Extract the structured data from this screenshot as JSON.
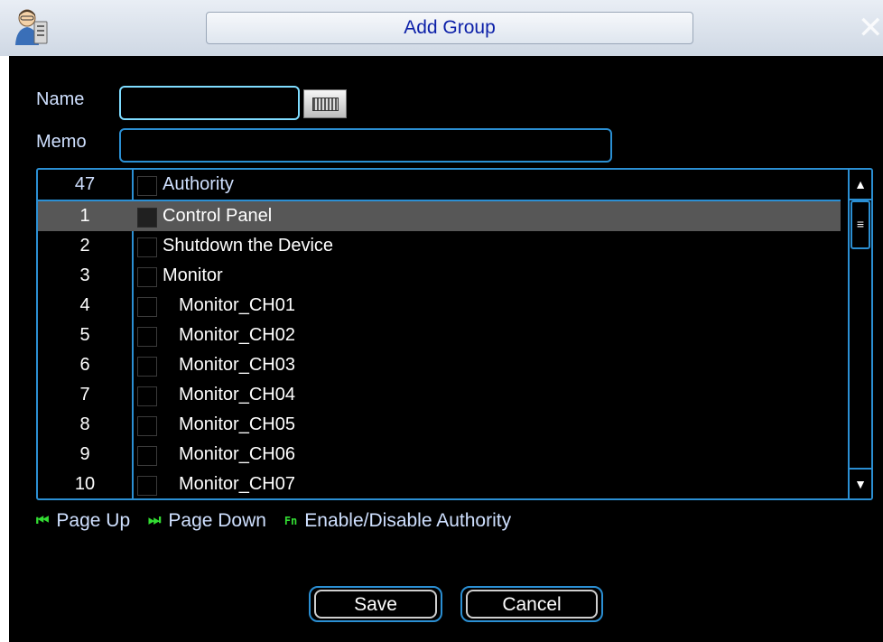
{
  "window": {
    "title": "Add Group",
    "close_icon": "close-icon",
    "app_icon": "user-group-icon"
  },
  "form": {
    "name_label": "Name",
    "name_value": "",
    "memo_label": "Memo",
    "memo_value": "",
    "keyboard_icon": "keyboard-icon"
  },
  "table": {
    "header": {
      "count": "47",
      "title": "Authority"
    },
    "rows": [
      {
        "num": "1",
        "name": "Control Panel",
        "selected": true
      },
      {
        "num": "2",
        "name": "Shutdown the Device"
      },
      {
        "num": "3",
        "name": "Monitor"
      },
      {
        "num": "4",
        "name": "Monitor_CH01"
      },
      {
        "num": "5",
        "name": "Monitor_CH02"
      },
      {
        "num": "6",
        "name": "Monitor_CH03"
      },
      {
        "num": "7",
        "name": "Monitor_CH04"
      },
      {
        "num": "8",
        "name": "Monitor_CH05"
      },
      {
        "num": "9",
        "name": "Monitor_CH06"
      },
      {
        "num": "10",
        "name": "Monitor_CH07"
      }
    ]
  },
  "hints": {
    "page_up": "Page Up",
    "page_down": "Page Down",
    "fn_key": "Fn",
    "enable_disable": "Enable/Disable Authority"
  },
  "buttons": {
    "save": "Save",
    "cancel": "Cancel"
  },
  "colors": {
    "accent": "#2b8fd3",
    "title_text": "#0b1fa8",
    "hint_icon": "#33dd33",
    "selected_row": "#575757"
  }
}
